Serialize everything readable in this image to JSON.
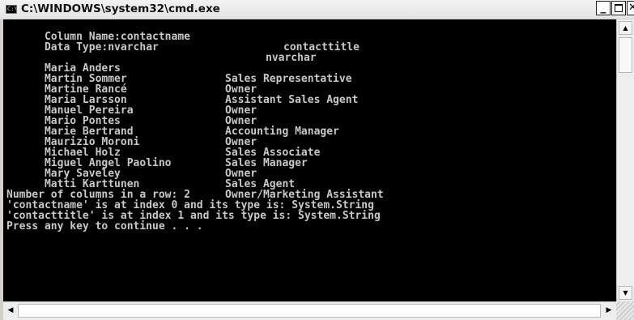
{
  "window": {
    "title": "C:\\WINDOWS\\system32\\cmd.exe",
    "icon_text": "C:\\"
  },
  "console": {
    "header": {
      "name_label": "Column Name:contactname",
      "name_col2": "contacttitle",
      "type_label": "Data Type:nvarchar",
      "type_col2": "nvarchar"
    },
    "rows": [
      {
        "name": "Maria Anders",
        "title": "Sales Representative"
      },
      {
        "name": "Martín Sommer",
        "title": "Owner"
      },
      {
        "name": "Martine Rancé",
        "title": "Assistant Sales Agent"
      },
      {
        "name": "Maria Larsson",
        "title": "Owner"
      },
      {
        "name": "Manuel Pereira",
        "title": "Owner"
      },
      {
        "name": "Mario Pontes",
        "title": "Accounting Manager"
      },
      {
        "name": "Marie Bertrand",
        "title": "Owner"
      },
      {
        "name": "Maurizio Moroni",
        "title": "Sales Associate"
      },
      {
        "name": "Michael Holz",
        "title": "Sales Manager"
      },
      {
        "name": "Miguel Angel Paolino",
        "title": "Owner"
      },
      {
        "name": "Mary Saveley",
        "title": "Sales Agent"
      },
      {
        "name": "Matti Karttunen",
        "title": "Owner/Marketing Assistant"
      }
    ],
    "footer": [
      "Number of columns in a row: 2",
      "'contactname' is at index 0 and its type is: System.String",
      "'contacttitle' is at index 1 and its type is: System.String",
      "Press any key to continue . . ."
    ]
  },
  "colors": {
    "console_bg": "#000000",
    "console_text": "#c8c8c8"
  },
  "icons": {
    "minimize": "minimize-icon",
    "maximize": "maximize-icon",
    "close": "close-icon",
    "scroll_up": "arrow-up-icon",
    "scroll_down": "arrow-down-icon",
    "scroll_left": "arrow-left-icon",
    "scroll_right": "arrow-right-icon"
  }
}
